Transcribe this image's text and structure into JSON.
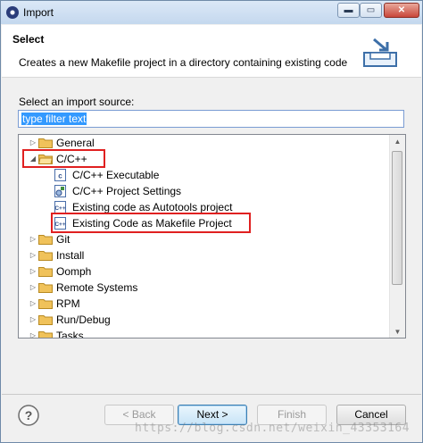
{
  "window": {
    "title": "Import",
    "min_glyph": "▬",
    "max_glyph": "▭",
    "close_glyph": "✕"
  },
  "header": {
    "title": "Select",
    "description": "Creates a new Makefile project in a directory containing existing code"
  },
  "source_label": "Select an import source:",
  "filter": {
    "value": "type filter text"
  },
  "tree": {
    "collapsed_arrow": "▷",
    "expanded_arrow": "◢",
    "items": [
      {
        "label": "General",
        "icon": "folder-icon",
        "expanded": false
      },
      {
        "label": "C/C++",
        "icon": "folder-open-icon",
        "expanded": true
      },
      {
        "label": "C/C++ Executable",
        "icon": "c-file-icon",
        "child": true
      },
      {
        "label": "C/C++ Project Settings",
        "icon": "project-settings-icon",
        "child": true
      },
      {
        "label": "Existing code as Autotools project",
        "icon": "cpp-file-icon",
        "child": true
      },
      {
        "label": "Existing Code as Makefile Project",
        "icon": "cpp-file-icon",
        "child": true,
        "selected": true
      },
      {
        "label": "Git",
        "icon": "folder-icon",
        "expanded": false
      },
      {
        "label": "Install",
        "icon": "folder-icon",
        "expanded": false
      },
      {
        "label": "Oomph",
        "icon": "folder-icon",
        "expanded": false
      },
      {
        "label": "Remote Systems",
        "icon": "folder-icon",
        "expanded": false
      },
      {
        "label": "RPM",
        "icon": "folder-icon",
        "expanded": false
      },
      {
        "label": "Run/Debug",
        "icon": "folder-icon",
        "expanded": false
      },
      {
        "label": "Tasks",
        "icon": "folder-icon",
        "expanded": false
      }
    ]
  },
  "buttons": {
    "back": "< Back",
    "next": "Next >",
    "finish": "Finish",
    "cancel": "Cancel",
    "help_glyph": "?"
  },
  "watermark": "https://blog.csdn.net/weixin_43353164",
  "colors": {
    "highlight": "#e02020",
    "selection": "#3399ff",
    "folder": "#f0c25a"
  }
}
